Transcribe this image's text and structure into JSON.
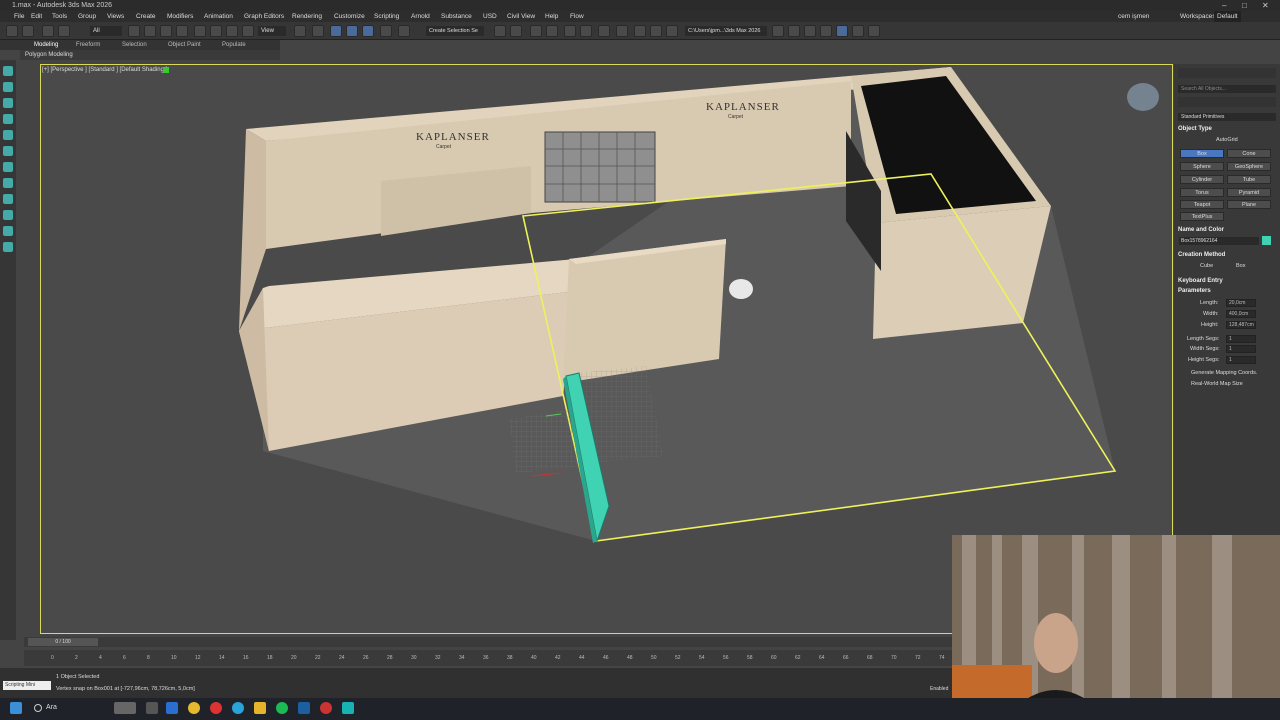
{
  "window": {
    "title": "1.max - Autodesk 3ds Max 2026",
    "min": "–",
    "max": "□",
    "close": "✕"
  },
  "menu": [
    "File",
    "Edit",
    "Tools",
    "Group",
    "Views",
    "Create",
    "Modifiers",
    "Animation",
    "Graph Editors",
    "Rendering",
    "Customize",
    "Scripting",
    "Arnold",
    "Substance",
    "USD",
    "Civil View",
    "Help",
    "Flow"
  ],
  "user": {
    "name": "cem işmen",
    "workspaces_label": "Workspaces:",
    "workspace": "Default"
  },
  "toolbar": {
    "filter": "All",
    "view": "View",
    "selset": "Create Selection Se",
    "path": "C:\\Users\\jpm...\\3ds Max 2026"
  },
  "ribbon": {
    "tabs": [
      "Modeling",
      "Freeform",
      "Selection",
      "Object Paint",
      "Populate"
    ],
    "active_panel": "Polygon Modeling"
  },
  "viewport": {
    "label": "[+] [Perspective ] [Standard ] [Default Shading ]",
    "logo1": "KAPLANSER",
    "logo1_sub": "Carpet",
    "logo2": "KAPLANSER",
    "logo2_sub": "Carpet"
  },
  "command_panel": {
    "search_placeholder": "Search All Objects...",
    "category": "Standard Primitives",
    "object_type_header": "Object Type",
    "autogrid": "AutoGrid",
    "primitives": [
      "Box",
      "Cone",
      "Sphere",
      "GeoSphere",
      "Cylinder",
      "Tube",
      "Torus",
      "Pyramid",
      "Teapot",
      "Plane",
      "TextPlus"
    ],
    "selected_primitive": "Box",
    "name_color_header": "Name and Color",
    "object_name": "Box1578962164",
    "object_color": "#3fd3b4",
    "creation_method_header": "Creation Method",
    "creation_methods": [
      "Cube",
      "Box"
    ],
    "keyboard_entry_header": "Keyboard Entry",
    "parameters_header": "Parameters",
    "length_label": "Length:",
    "length": "20,0cm",
    "width_label": "Width:",
    "width": "400,0cm",
    "height_label": "Height:",
    "height": "128,487cm",
    "length_segs_label": "Length Segs:",
    "length_segs": "1",
    "width_segs_label": "Width Segs:",
    "width_segs": "1",
    "height_segs_label": "Height Segs:",
    "height_segs": "1",
    "gen_mapping": "Generate Mapping Coords.",
    "real_world": "Real-World Map Size"
  },
  "timeline": {
    "frame": "0 / 100",
    "ticks": [
      "0",
      "2",
      "4",
      "6",
      "8",
      "10",
      "12",
      "14",
      "16",
      "18",
      "20",
      "22",
      "24",
      "26",
      "28",
      "30",
      "32",
      "34",
      "36",
      "38",
      "40",
      "42",
      "44",
      "46",
      "48",
      "50",
      "52",
      "54",
      "56",
      "58",
      "60",
      "62",
      "64",
      "66",
      "68",
      "70",
      "72",
      "74"
    ]
  },
  "status": {
    "script_label": "Scripting Mini",
    "selected": "1 Object Selected",
    "prompt": "Vertex snap on Box001 at [-727,96cm, 78,726cm, 5,0cm]",
    "enabled": "Enabled"
  },
  "taskbar": {
    "search": "Ara"
  }
}
